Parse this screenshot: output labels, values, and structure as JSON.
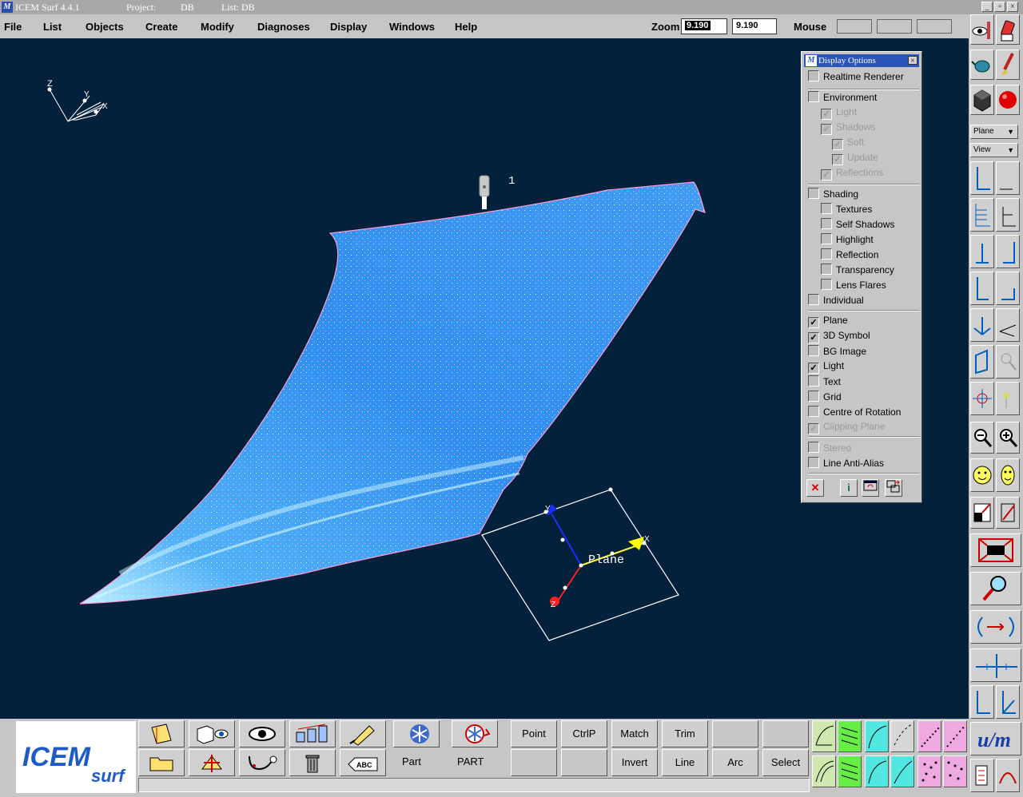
{
  "window": {
    "title": "ICEM Surf 4.4.1",
    "project_label": "Project:",
    "project_value": "DB",
    "list_label": "List: DB",
    "minimize": "_",
    "maximize": "▫",
    "close": "×"
  },
  "menu": {
    "items": [
      "File",
      "List",
      "Objects",
      "Create",
      "Modify",
      "Diagnoses",
      "Display",
      "Windows",
      "Help"
    ],
    "zoom_label": "Zoom",
    "zoom_value_1": "9.190",
    "zoom_value_2": "9.190",
    "mouse_label": "Mouse"
  },
  "viewport": {
    "marker_number": "1",
    "plane_label": "Plane",
    "axis_labels": {
      "z": "Z",
      "y": "Y",
      "x": "X"
    },
    "plane_axis_labels": {
      "y": "Y",
      "x": "X",
      "z": "Z"
    },
    "colors": {
      "background": "#03213a",
      "surface": "#2f8ff0"
    }
  },
  "display_options": {
    "title": "Display Options",
    "close": "×",
    "items": [
      {
        "label": "Realtime Renderer",
        "checked": false,
        "disabled": false
      },
      {
        "label": "Environment",
        "checked": false,
        "disabled": false
      },
      {
        "label": "Light",
        "checked": true,
        "disabled": true
      },
      {
        "label": "Shadows",
        "checked": true,
        "disabled": true
      },
      {
        "label": "Soft",
        "checked": true,
        "disabled": true
      },
      {
        "label": "Update",
        "checked": true,
        "disabled": true
      },
      {
        "label": "Reflections",
        "checked": true,
        "disabled": true
      },
      {
        "label": "Shading",
        "checked": false,
        "disabled": false
      },
      {
        "label": "Textures",
        "checked": false,
        "disabled": false
      },
      {
        "label": "Self Shadows",
        "checked": false,
        "disabled": false
      },
      {
        "label": "Highlight",
        "checked": false,
        "disabled": false
      },
      {
        "label": "Reflection",
        "checked": false,
        "disabled": false
      },
      {
        "label": "Transparency",
        "checked": false,
        "disabled": false
      },
      {
        "label": "Lens Flares",
        "checked": false,
        "disabled": false
      },
      {
        "label": "Individual",
        "checked": false,
        "disabled": false
      },
      {
        "label": "Plane",
        "checked": true,
        "disabled": false
      },
      {
        "label": "3D Symbol",
        "checked": true,
        "disabled": false
      },
      {
        "label": "BG Image",
        "checked": false,
        "disabled": false
      },
      {
        "label": "Light",
        "checked": true,
        "disabled": false
      },
      {
        "label": "Text",
        "checked": false,
        "disabled": false
      },
      {
        "label": "Grid",
        "checked": false,
        "disabled": false
      },
      {
        "label": "Centre of Rotation",
        "checked": false,
        "disabled": false
      },
      {
        "label": "Clipping Plane",
        "checked": true,
        "disabled": true
      },
      {
        "label": "Stereo",
        "checked": false,
        "disabled": true
      },
      {
        "label": "Line Anti-Alias",
        "checked": false,
        "disabled": false
      }
    ],
    "check_mark": "✓",
    "buttons": {
      "cancel": "✕",
      "info": "i"
    }
  },
  "right_toolbar": {
    "plane_select": "Plane",
    "view_select": "View",
    "dropdown_arrow": "▼"
  },
  "bottom_toolbar": {
    "logo_text_1": "ICEM",
    "logo_text_2": "surf",
    "text_buttons": [
      "Point",
      "CtrlP",
      "Match",
      "Trim",
      "Invert",
      "Line",
      "Arc",
      "Select"
    ],
    "part_label": "Part",
    "part_value": "PART",
    "abc": "ABC"
  }
}
